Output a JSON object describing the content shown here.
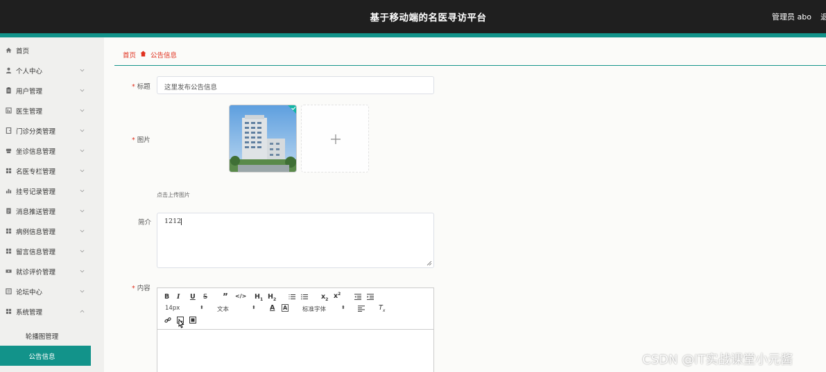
{
  "header": {
    "title": "基于移动端的名医寻访平台",
    "user": "管理员 abo",
    "logout": "退"
  },
  "sidebar": {
    "items": [
      {
        "label": "首页",
        "icon": "home-icon"
      },
      {
        "label": "个人中心",
        "icon": "user-icon"
      },
      {
        "label": "用户管理",
        "icon": "clipboard-icon"
      },
      {
        "label": "医生管理",
        "icon": "bar-chart-icon"
      },
      {
        "label": "门诊分类管理",
        "icon": "door-icon"
      },
      {
        "label": "坐诊信息管理",
        "icon": "desk-icon"
      },
      {
        "label": "名医专栏管理",
        "icon": "grid-icon"
      },
      {
        "label": "挂号记录管理",
        "icon": "chart-icon"
      },
      {
        "label": "消息推送管理",
        "icon": "document-icon"
      },
      {
        "label": "病例信息管理",
        "icon": "grid-icon"
      },
      {
        "label": "留言信息管理",
        "icon": "grid-icon"
      },
      {
        "label": "就诊评价管理",
        "icon": "ticket-icon"
      },
      {
        "label": "论坛中心",
        "icon": "forum-icon"
      },
      {
        "label": "系统管理",
        "icon": "settings-grid-icon"
      }
    ],
    "sub_items": [
      {
        "label": "轮播图管理"
      },
      {
        "label": "公告信息"
      }
    ]
  },
  "breadcrumb": {
    "home": "首页",
    "current": "公告信息"
  },
  "form": {
    "title_label": "标题",
    "title_value": "这里发布公告信息",
    "image_label": "图片",
    "upload_hint": "点击上传图片",
    "intro_label": "简介",
    "intro_value": "1212",
    "content_label": "内容"
  },
  "editor": {
    "font_size": "14px",
    "paragraph": "文本",
    "font_family": "标准字体"
  },
  "watermark": "CSDN @IT实战课堂小元酱",
  "colors": {
    "accent": "#12938a",
    "header_bg": "#1f1f1f",
    "required": "#e0301e"
  }
}
